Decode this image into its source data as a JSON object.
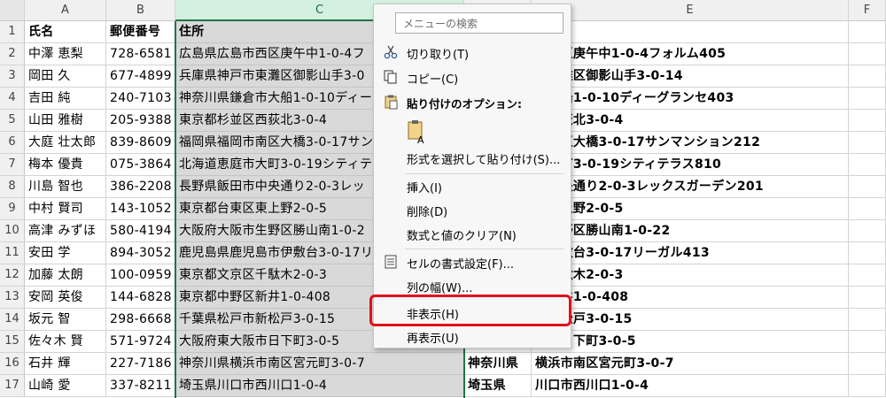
{
  "columns": [
    "",
    "A",
    "B",
    "C",
    "D",
    "E",
    "F"
  ],
  "row_numbers": [
    "1",
    "2",
    "3",
    "4",
    "5",
    "6",
    "7",
    "8",
    "9",
    "10",
    "11",
    "12",
    "13",
    "14",
    "15",
    "16",
    "17"
  ],
  "headers": {
    "a": "氏名",
    "b": "郵便番号",
    "c": "住所"
  },
  "rows": [
    {
      "a": "中澤 恵梨",
      "b": "728-6581",
      "c": "広島県広島市西区庚午中1-0-4フ",
      "d": "",
      "e": "市西区庚午中1-0-4フォルム405"
    },
    {
      "a": "岡田 久",
      "b": "677-4899",
      "c": "兵庫県神戸市東灘区御影山手3-0",
      "d": "",
      "e": "市東灘区御影山手3-0-14"
    },
    {
      "a": "吉田 純",
      "b": "240-7103",
      "c": "神奈川県鎌倉市大船1-0-10ディー",
      "d": "",
      "e": "市大船1-0-10ディーグランセ403"
    },
    {
      "a": "山田 雅樹",
      "b": "205-9388",
      "c": "東京都杉並区西荻北3-0-4",
      "d": "",
      "e": "区西荻北3-0-4"
    },
    {
      "a": "大庭 壮太郎",
      "b": "839-8609",
      "c": "福岡県福岡市南区大橋3-0-17サン",
      "d": "",
      "e": "市南区大橋3-0-17サンマンション212"
    },
    {
      "a": "梅本 優貴",
      "b": "075-3864",
      "c": "北海道恵庭市大町3-0-19シティテ",
      "d": "",
      "e": "市大町3-0-19シティテラス810"
    },
    {
      "a": "川島 智也",
      "b": "386-2208",
      "c": "長野県飯田市中央通り2-0-3レッ",
      "d": "",
      "e": "市中央通り2-0-3レックスガーデン201"
    },
    {
      "a": "中村 賢司",
      "b": "143-1052",
      "c": "東京都台東区東上野2-0-5",
      "d": "",
      "e": "区東上野2-0-5"
    },
    {
      "a": "高津 みずほ",
      "b": "580-4194",
      "c": "大阪府大阪市生野区勝山南1-0-2",
      "d": "",
      "e": "市生野区勝山南1-0-22"
    },
    {
      "a": "安田 学",
      "b": "894-3052",
      "c": "鹿児島県鹿児島市伊敷台3-0-17リ",
      "d": "",
      "e": "市伊敷台3-0-17リーガル413"
    },
    {
      "a": "加藤 太朗",
      "b": "100-0959",
      "c": "東京都文京区千駄木2-0-3",
      "d": "",
      "e": "区千駄木2-0-3"
    },
    {
      "a": "安岡 英俊",
      "b": "144-6828",
      "c": "東京都中野区新井1-0-408",
      "d": "",
      "e": "区新井1-0-408"
    },
    {
      "a": "坂元 智",
      "b": "298-6668",
      "c": "千葉県松戸市新松戸3-0-15",
      "d": "",
      "e": "市新松戸3-0-15"
    },
    {
      "a": "佐々木 賢",
      "b": "571-9724",
      "c": "大阪府東大阪市日下町3-0-5",
      "d": "",
      "e": "阪市日下町3-0-5"
    },
    {
      "a": "石井 輝",
      "b": "227-7186",
      "c": "神奈川県横浜市南区宮元町3-0-7",
      "d": "神奈川県",
      "e": "横浜市南区宮元町3-0-7"
    },
    {
      "a": "山崎 愛",
      "b": "337-8211",
      "c": "埼玉県川口市西川口1-0-4",
      "d": "埼玉県",
      "e": "川口市西川口1-0-4"
    }
  ],
  "context_menu": {
    "search_placeholder": "メニューの検索",
    "cut": "切り取り(T)",
    "copy": "コピー(C)",
    "paste_options": "貼り付けのオプション:",
    "paste_special": "形式を選択して貼り付け(S)...",
    "insert": "挿入(I)",
    "delete": "削除(D)",
    "clear_contents": "数式と値のクリア(N)",
    "format_cells": "セルの書式設定(F)...",
    "column_width": "列の幅(W)...",
    "hide": "非表示(H)",
    "unhide": "再表示(U)"
  },
  "colors": {
    "selection_green": "#217346",
    "highlight_red": "#e0101a",
    "selected_col_bg": "#d9d9d9"
  }
}
